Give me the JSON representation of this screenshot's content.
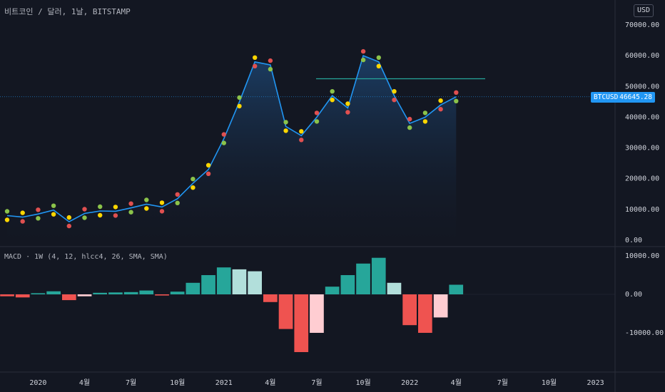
{
  "header": {
    "title": "비트코인 / 달러, 1날, BITSTAMP",
    "currency_button": "USD"
  },
  "price_tag": {
    "symbol": "BTCUSD",
    "value": "46645.28"
  },
  "macd_label": "MACD · 1W (4, 12, hlcc4, 26, SMA, SMA)",
  "colors": {
    "background": "#131722",
    "price_line": "#2196f3",
    "resistance": "#26a69a",
    "dot_green": "#8bc34a",
    "dot_yellow": "#ffd600",
    "dot_red": "#e05050",
    "hist_green_strong": "#26a69a",
    "hist_green_light": "#b2dfdb",
    "hist_red_strong": "#ef5350",
    "hist_red_light": "#ffcdd2"
  },
  "chart_data": [
    {
      "type": "line",
      "name": "price",
      "y_axis_ticks": [
        "70000.00",
        "60000.00",
        "50000.00",
        "40000.00",
        "30000.00",
        "20000.00",
        "10000.00",
        "0.00"
      ],
      "ylim": [
        0,
        75000
      ],
      "x_axis_ticks": [
        "2020",
        "4월",
        "7월",
        "10월",
        "2021",
        "4월",
        "7월",
        "10월",
        "2022",
        "4월",
        "7월",
        "10월",
        "2023"
      ],
      "x": [
        "2019-11",
        "2019-12",
        "2020-01",
        "2020-02",
        "2020-03",
        "2020-04",
        "2020-05",
        "2020-06",
        "2020-07",
        "2020-08",
        "2020-09",
        "2020-10",
        "2020-11",
        "2020-12",
        "2021-01",
        "2021-02",
        "2021-03",
        "2021-04",
        "2021-05",
        "2021-06",
        "2021-07",
        "2021-08",
        "2021-09",
        "2021-10",
        "2021-11",
        "2021-12",
        "2022-01",
        "2022-02",
        "2022-03",
        "2022-04"
      ],
      "values": [
        8000,
        7500,
        8500,
        9800,
        6000,
        8700,
        9500,
        9400,
        10500,
        11700,
        10800,
        13500,
        18500,
        23000,
        33000,
        45000,
        58000,
        57000,
        37000,
        34000,
        40000,
        47000,
        43000,
        60000,
        58000,
        47000,
        38000,
        40000,
        44000,
        46645
      ],
      "resistance_level": 52500,
      "current_price": 46645.28
    },
    {
      "type": "bar",
      "name": "MACD histogram",
      "y_axis_ticks": [
        "10000.00",
        "0.00",
        "-10000.00"
      ],
      "ylim": [
        -18000,
        11000
      ],
      "x": [
        "2019-11",
        "2019-12",
        "2020-01",
        "2020-02",
        "2020-03",
        "2020-04",
        "2020-05",
        "2020-06",
        "2020-07",
        "2020-08",
        "2020-09",
        "2020-10",
        "2020-11",
        "2020-12",
        "2021-01",
        "2021-02",
        "2021-03",
        "2021-04",
        "2021-05",
        "2021-06",
        "2021-07",
        "2021-08",
        "2021-09",
        "2021-10",
        "2021-11",
        "2021-12",
        "2022-01",
        "2022-02",
        "2022-03",
        "2022-04"
      ],
      "values": [
        -500,
        -800,
        300,
        800,
        -1500,
        -500,
        400,
        500,
        600,
        1000,
        -300,
        700,
        3000,
        5000,
        7000,
        6500,
        6000,
        -2000,
        -9000,
        -15000,
        -10000,
        2000,
        5000,
        8000,
        9500,
        3000,
        -8000,
        -10000,
        -6000,
        2500
      ]
    }
  ]
}
